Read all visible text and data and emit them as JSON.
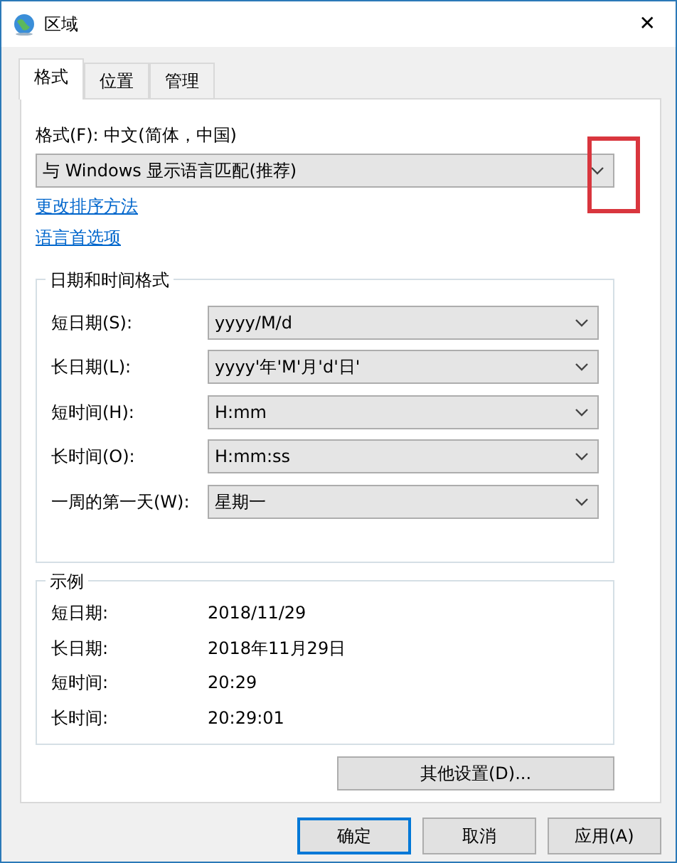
{
  "window": {
    "title": "区域",
    "close": "✕"
  },
  "tabs": [
    {
      "label": "格式",
      "selected": true
    },
    {
      "label": "位置",
      "selected": false
    },
    {
      "label": "管理",
      "selected": false
    }
  ],
  "format": {
    "label": "格式(F): 中文(简体，中国)",
    "value": "与 Windows 显示语言匹配(推荐)",
    "highlighted": true
  },
  "links": [
    "更改排序方法",
    "语言首选项"
  ],
  "date_time_formats": {
    "title": "日期和时间格式",
    "rows": [
      {
        "label": "短日期(S):",
        "value": "yyyy/M/d"
      },
      {
        "label": "长日期(L):",
        "value": "yyyy'年'M'月'd'日'"
      },
      {
        "label": "短时间(H):",
        "value": "H:mm"
      },
      {
        "label": "长时间(O):",
        "value": "H:mm:ss"
      },
      {
        "label": "一周的第一天(W):",
        "value": "星期一"
      }
    ]
  },
  "examples": {
    "title": "示例",
    "rows": [
      {
        "label": "短日期:",
        "value": "2018/11/29"
      },
      {
        "label": "长日期:",
        "value": "2018年11月29日"
      },
      {
        "label": "短时间:",
        "value": "20:29"
      },
      {
        "label": "长时间:",
        "value": "20:29:01"
      }
    ]
  },
  "other_settings_button": "其他设置(D)...",
  "buttons": [
    {
      "label": "确定",
      "default": true
    },
    {
      "label": "取消",
      "default": false
    },
    {
      "label": "应用(A)",
      "default": false
    }
  ]
}
